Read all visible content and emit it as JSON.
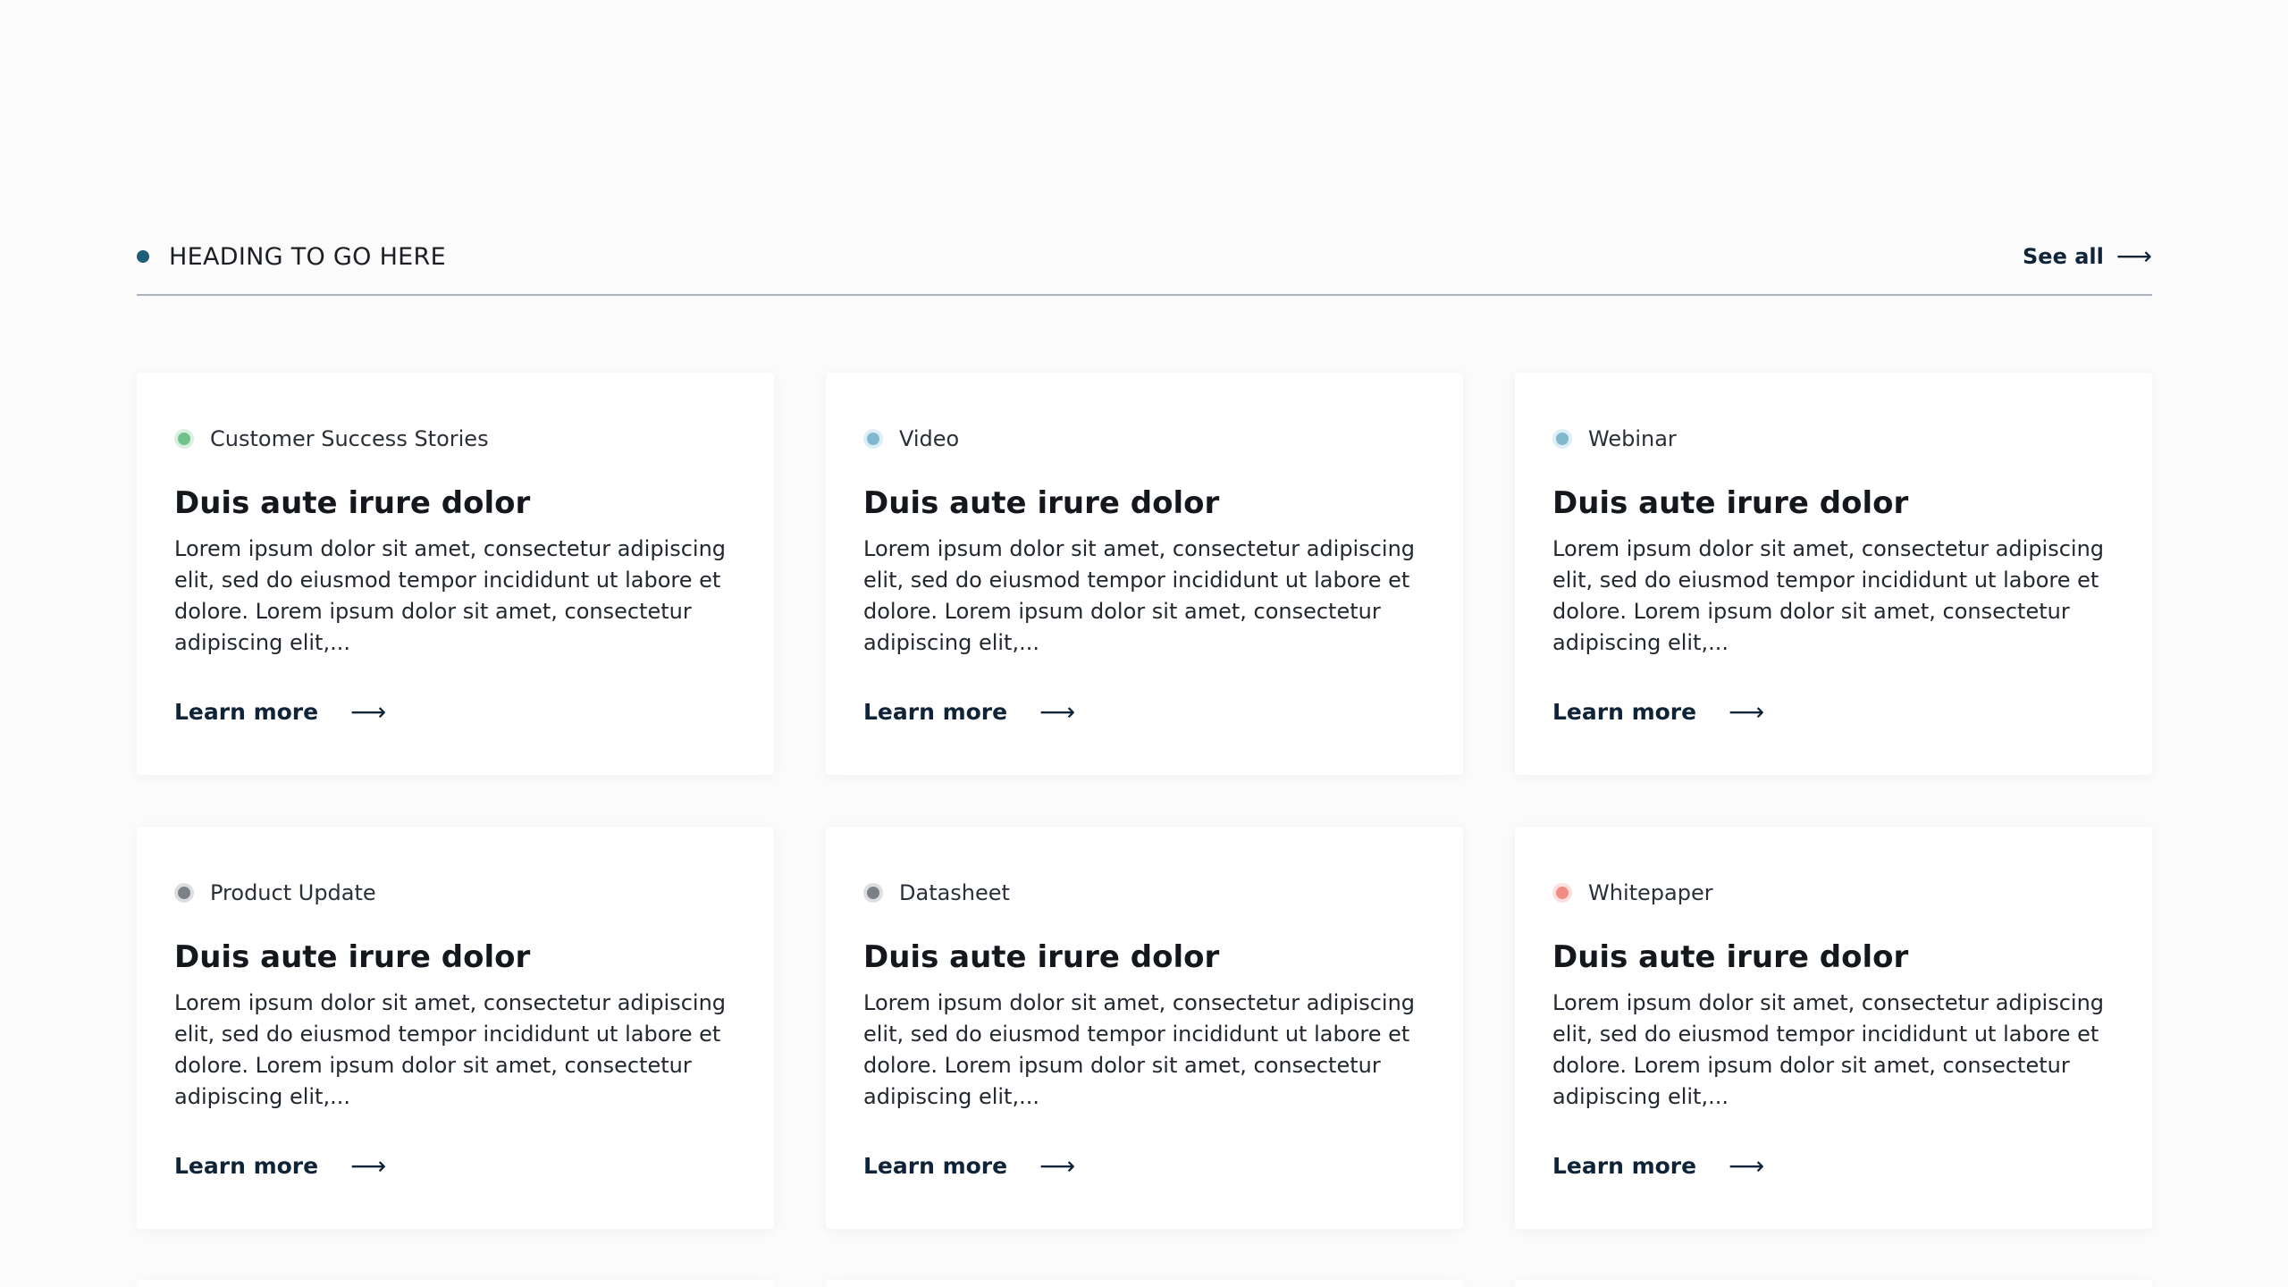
{
  "section": {
    "heading": "HEADING TO GO HERE",
    "see_all_label": "See all",
    "arrow_glyph": "⟶"
  },
  "accent_colors": {
    "heading_dot": "#1d5f78",
    "link": "#0f2438",
    "divider": "#a9b4c2"
  },
  "cards": [
    {
      "tag": "Customer Success Stories",
      "tag_color": "#6fc38a",
      "tag_border": "#d9efe0",
      "title": "Duis aute irure dolor",
      "description": "Lorem ipsum dolor sit amet, consectetur adipiscing elit, sed do eiusmod tempor incididunt ut labore et dolore. Lorem ipsum dolor sit amet, consectetur adipiscing elit,...",
      "link_label": "Learn more"
    },
    {
      "tag": "Video",
      "tag_color": "#7fb8cf",
      "tag_border": "#ddeef5",
      "title": "Duis aute irure dolor",
      "description": "Lorem ipsum dolor sit amet, consectetur adipiscing elit, sed do eiusmod tempor incididunt ut labore et dolore. Lorem ipsum dolor sit amet, consectetur adipiscing elit,...",
      "link_label": "Learn more"
    },
    {
      "tag": "Webinar",
      "tag_color": "#7fb8cf",
      "tag_border": "#ddeef5",
      "title": "Duis aute irure dolor",
      "description": "Lorem ipsum dolor sit amet, consectetur adipiscing elit, sed do eiusmod tempor incididunt ut labore et dolore. Lorem ipsum dolor sit amet, consectetur adipiscing elit,...",
      "link_label": "Learn more"
    },
    {
      "tag": "Product Update",
      "tag_color": "#7c8186",
      "tag_border": "#dcdee0",
      "title": "Duis aute irure dolor",
      "description": "Lorem ipsum dolor sit amet, consectetur adipiscing elit, sed do eiusmod tempor incididunt ut labore et dolore. Lorem ipsum dolor sit amet, consectetur adipiscing elit,...",
      "link_label": "Learn more"
    },
    {
      "tag": "Datasheet",
      "tag_color": "#7c8186",
      "tag_border": "#dcdee0",
      "title": "Duis aute irure dolor",
      "description": "Lorem ipsum dolor sit amet, consectetur adipiscing elit, sed do eiusmod tempor incididunt ut labore et dolore. Lorem ipsum dolor sit amet, consectetur adipiscing elit,...",
      "link_label": "Learn more"
    },
    {
      "tag": "Whitepaper",
      "tag_color": "#f08c84",
      "tag_border": "#fbe0dd",
      "title": "Duis aute irure dolor",
      "description": "Lorem ipsum dolor sit amet, consectetur adipiscing elit, sed do eiusmod tempor incididunt ut labore et dolore. Lorem ipsum dolor sit amet, consectetur adipiscing elit,...",
      "link_label": "Learn more"
    }
  ]
}
